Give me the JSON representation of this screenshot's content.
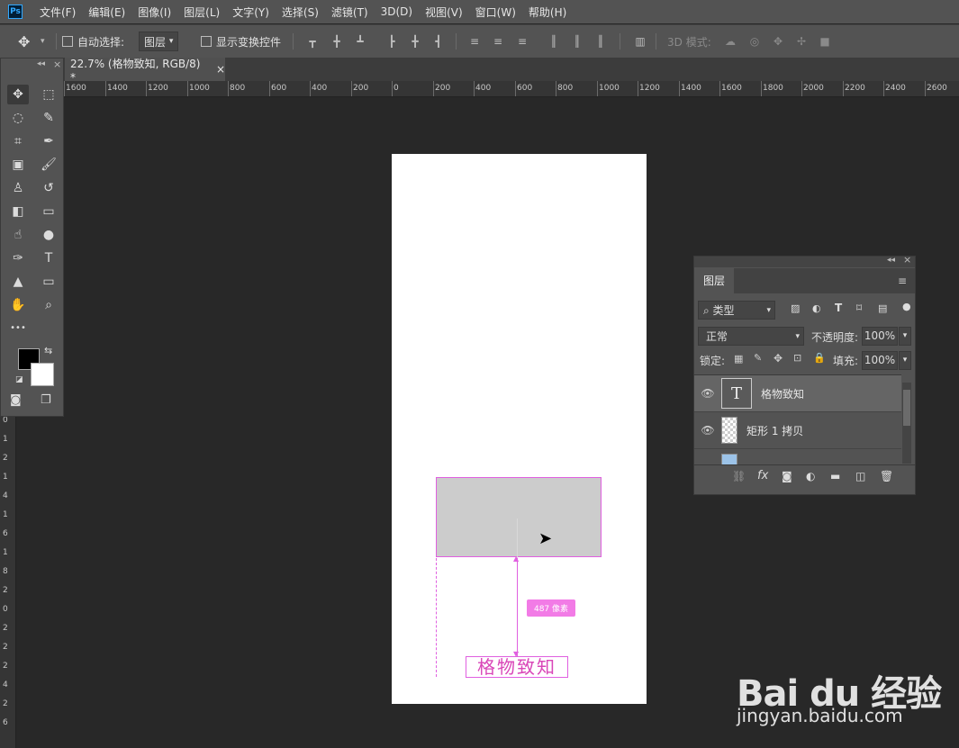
{
  "app": {
    "logo_text": "Ps"
  },
  "menu": [
    "文件(F)",
    "编辑(E)",
    "图像(I)",
    "图层(L)",
    "文字(Y)",
    "选择(S)",
    "滤镜(T)",
    "3D(D)",
    "视图(V)",
    "窗口(W)",
    "帮助(H)"
  ],
  "options": {
    "move_icon": "✥",
    "auto_select_label": "自动选择:",
    "auto_select_value": "图层",
    "show_transform_label": "显示变换控件",
    "mode_3d_label": "3D 模式:"
  },
  "tab": {
    "title": "22.7% (格物致知, RGB/8) *",
    "close": "×"
  },
  "ruler_labels": [
    "1600",
    "1400",
    "1200",
    "1000",
    "800",
    "600",
    "400",
    "200",
    "0",
    "200",
    "400",
    "600",
    "800",
    "1000",
    "1200",
    "1400",
    "1600",
    "1800",
    "2000",
    "2200",
    "2400",
    "2600"
  ],
  "vruler_labels": [
    "0",
    "1",
    "2",
    "1",
    "4",
    "1",
    "6",
    "1",
    "8",
    "2",
    "0",
    "2",
    "2",
    "2",
    "4",
    "2",
    "6"
  ],
  "tools": [
    {
      "name": "move-tool",
      "icon": "✥"
    },
    {
      "name": "marquee-tool",
      "icon": "⬚"
    },
    {
      "name": "lasso-tool",
      "icon": "◌"
    },
    {
      "name": "quick-select-tool",
      "icon": "✎"
    },
    {
      "name": "crop-tool",
      "icon": "⌗"
    },
    {
      "name": "eyedropper-tool",
      "icon": "✒"
    },
    {
      "name": "frame-tool",
      "icon": "▣"
    },
    {
      "name": "brush-tool",
      "icon": "🖌"
    },
    {
      "name": "stamp-tool",
      "icon": "♙"
    },
    {
      "name": "history-brush-tool",
      "icon": "↺"
    },
    {
      "name": "eraser-tool",
      "icon": "◧"
    },
    {
      "name": "gradient-tool",
      "icon": "▭"
    },
    {
      "name": "smudge-tool",
      "icon": "☝"
    },
    {
      "name": "dodge-tool",
      "icon": "●"
    },
    {
      "name": "pen-tool",
      "icon": "✑"
    },
    {
      "name": "type-tool",
      "icon": "T"
    },
    {
      "name": "path-select-tool",
      "icon": "▲"
    },
    {
      "name": "shape-tool",
      "icon": "▭"
    },
    {
      "name": "hand-tool",
      "icon": "✋"
    },
    {
      "name": "zoom-tool",
      "icon": "⌕"
    },
    {
      "name": "more-tools",
      "icon": "•••"
    },
    {
      "name": "swap-colors-icon",
      "icon": "⇆"
    }
  ],
  "canvas": {
    "text": "格物致知",
    "measure": "487 像素"
  },
  "layers_panel": {
    "tab": "图层",
    "filter_label": "⌕ 类型",
    "blend_mode": "正常",
    "opacity_label": "不透明度:",
    "opacity_value": "100%",
    "lock_label": "锁定:",
    "fill_label": "填充:",
    "fill_value": "100%",
    "layers": [
      {
        "name": "格物致知",
        "thumb": "T"
      },
      {
        "name": "矩形 1 拷贝",
        "thumb": ""
      }
    ],
    "footer_icons": [
      "link-icon",
      "fx-icon",
      "mask-icon",
      "adjustment-icon",
      "folder-icon",
      "new-layer-icon",
      "trash-icon"
    ]
  },
  "watermark": {
    "logo": "Bai du 经验",
    "url": "jingyan.baidu.com"
  }
}
